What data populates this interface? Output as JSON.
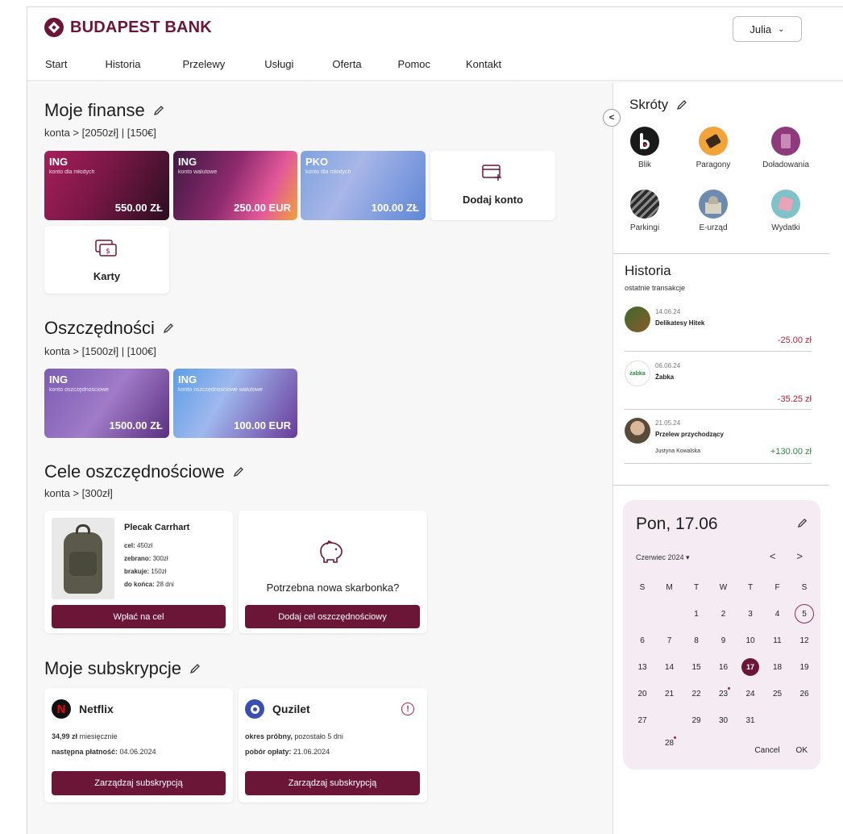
{
  "brand": {
    "name": "BUDAPEST BANK",
    "color": "#6b1637"
  },
  "user": {
    "name": "Julia"
  },
  "nav": [
    "Start",
    "Historia",
    "Przelewy",
    "Usługi",
    "Oferta",
    "Pomoc",
    "Kontakt"
  ],
  "finanse": {
    "title": "Moje finanse",
    "summary": "konta > [2050zł] | [150€]",
    "accounts": [
      {
        "bank": "ING",
        "desc": "konto dla młodych",
        "amount": "550.00 ZŁ"
      },
      {
        "bank": "ING",
        "desc": "konto walutowe",
        "amount": "250.00 EUR"
      },
      {
        "bank": "PKO",
        "desc": "konto dla młodych",
        "amount": "100.00 ZŁ"
      }
    ],
    "add_account": "Dodaj konto",
    "cards": "Karty"
  },
  "oszczednosci": {
    "title": "Oszczędności",
    "summary": "konta > [1500zł] | [100€]",
    "accounts": [
      {
        "bank": "ING",
        "desc": "konto oszczędnościowe",
        "amount": "1500.00 ZŁ"
      },
      {
        "bank": "ING",
        "desc": "konto oszczędnościowe walutowe",
        "amount": "100.00 EUR"
      }
    ]
  },
  "cele": {
    "title": "Cele oszczędnościowe",
    "summary": "konta > [300zł]",
    "goal": {
      "name": "Plecak Carrhart",
      "cel_label": "cel:",
      "cel": "450zł",
      "zebrano_label": "zebrano:",
      "zebrano": "300zł",
      "brakuje_label": "brakuje:",
      "brakuje": "150zł",
      "konca_label": "do końca:",
      "konca": "28 dni",
      "button": "Wpłać na cel"
    },
    "new_goal": {
      "text": "Potrzebna nowa skarbonka?",
      "button": "Dodaj cel oszczędnościowy"
    }
  },
  "subskrypcje": {
    "title": "Moje subskrypcje",
    "netflix": {
      "name": "Netflix",
      "price_bold": "34,99 zł",
      "price_rest": "miesięcznie",
      "next_label": "następna płatność:",
      "next": "04.06.2024",
      "button": "Zarządzaj subskrypcją"
    },
    "quzilet": {
      "name": "Quzilet",
      "trial_bold": "okres próbny,",
      "trial_rest": "pozostało 5 dni",
      "charge_label": "pobór opłaty:",
      "charge": "21.06.2024",
      "button": "Zarządzaj subskrypcją"
    }
  },
  "skroty": {
    "title": "Skróty",
    "items": [
      "Blik",
      "Paragony",
      "Doładowania",
      "Parkingi",
      "E-urząd",
      "Wydatki"
    ]
  },
  "historia": {
    "title": "Historia",
    "subtitle": "ostatnie transakcje",
    "transactions": [
      {
        "date": "14.06.24",
        "who": "Delikatesy Hitek",
        "extra": "",
        "amount": "-25.00 zł"
      },
      {
        "date": "06.06.24",
        "who": "Żabka",
        "extra": "",
        "amount": "-35.25 zł"
      },
      {
        "date": "21.05.24",
        "who": "Przelew przychodzący",
        "extra": "Justyna Kowalska",
        "amount": "+130.00 zł"
      }
    ],
    "zabka_logo": "żabka"
  },
  "calendar": {
    "heading": "Pon, 17.06",
    "month": "Czerwiec 2024",
    "prev": "<",
    "next": ">",
    "dow": [
      "S",
      "M",
      "T",
      "W",
      "T",
      "F",
      "S"
    ],
    "weeks": [
      [
        "",
        "",
        "1",
        "2",
        "3",
        "4",
        "5"
      ],
      [
        "6",
        "7",
        "8",
        "9",
        "10",
        "11",
        "12"
      ],
      [
        "13",
        "14",
        "15",
        "16",
        "17",
        "18",
        "19"
      ],
      [
        "20",
        "21",
        "22",
        "23",
        "24",
        "25",
        "26"
      ],
      [
        "27",
        "28",
        "29",
        "30",
        "31",
        "",
        ""
      ]
    ],
    "selected": "17",
    "today": "5",
    "marked": [
      "23",
      "28"
    ],
    "cancel": "Cancel",
    "ok": "OK"
  }
}
